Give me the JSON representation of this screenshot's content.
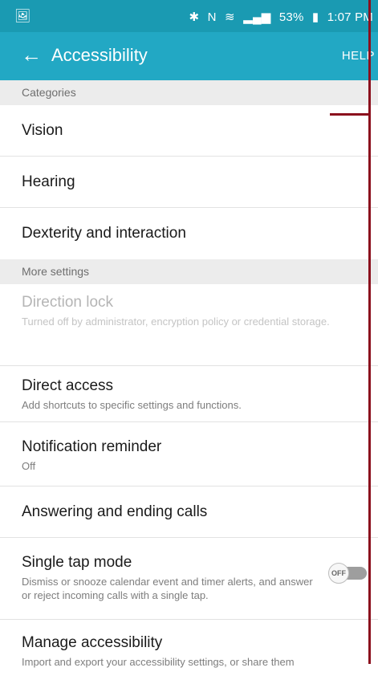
{
  "status": {
    "left_icon": "photo-notification-icon",
    "right": [
      "✱",
      "N",
      "wifi",
      "signal",
      "53%",
      "battery",
      "1:07 PM"
    ]
  },
  "appbar": {
    "title": "Accessibility",
    "help": "HELP",
    "back_icon": "back-arrow-icon"
  },
  "sections": {
    "categories": "Categories",
    "more": "More settings"
  },
  "categories": [
    "Vision",
    "Hearing",
    "Dexterity and interaction"
  ],
  "more_items": {
    "direction_lock": {
      "title": "Direction lock",
      "subtitle": "Turned off by administrator, encryption policy or credential storage."
    },
    "direct_access": {
      "title": "Direct access",
      "subtitle": "Add shortcuts to specific settings and functions."
    },
    "notification_reminder": {
      "title": "Notification reminder",
      "subtitle": "Off"
    },
    "answering": {
      "title": "Answering and ending calls"
    },
    "single_tap": {
      "title": "Single tap mode",
      "subtitle": "Dismiss or snooze calendar event and timer alerts, and answer or reject incoming calls with a single tap.",
      "toggle": "OFF"
    },
    "manage": {
      "title": "Manage accessibility",
      "subtitle": "Import and export your accessibility settings, or share them"
    }
  },
  "colors": {
    "status_bar": "#1a9ab2",
    "app_bar": "#22a8c4",
    "annotation_line": "#8b0f1d"
  }
}
